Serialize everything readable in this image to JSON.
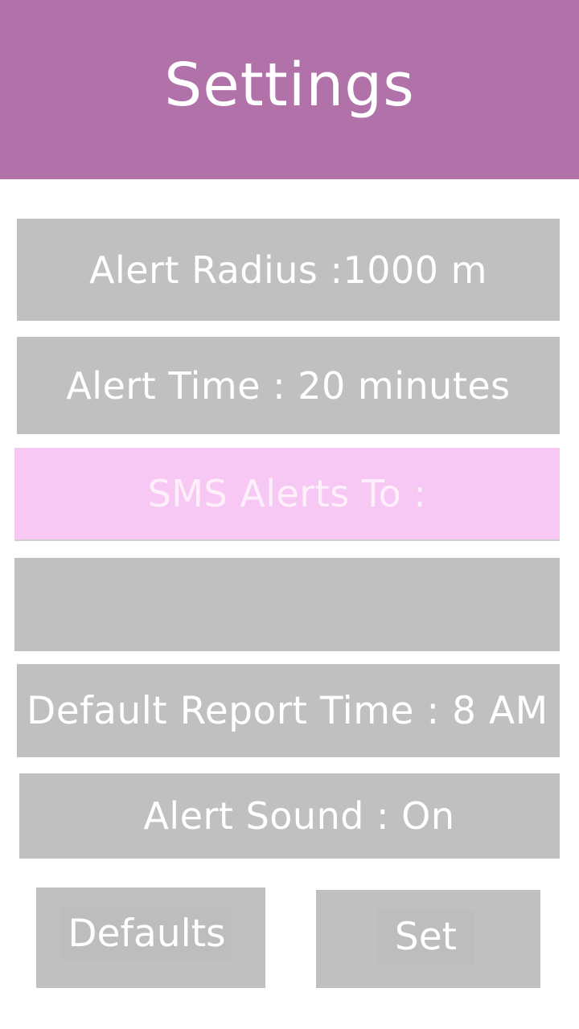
{
  "header": {
    "title": "Settings",
    "background": "#b072a8"
  },
  "settings": {
    "alert_radius": "Alert Radius :1000 m",
    "alert_time": "Alert Time : 20 minutes",
    "sms_alerts_label": "SMS Alerts To :",
    "sms_value": "",
    "sms_placeholder": "",
    "default_report_time": "Default Report Time : 8 AM",
    "alert_sound": "Alert Sound : On"
  },
  "buttons": {
    "defaults_label": "Defaults",
    "set_label": "Set"
  },
  "colors": {
    "row_gray": "#c0c0c0",
    "sms_pink": "#f8c8f4",
    "text": "#ffffff"
  }
}
